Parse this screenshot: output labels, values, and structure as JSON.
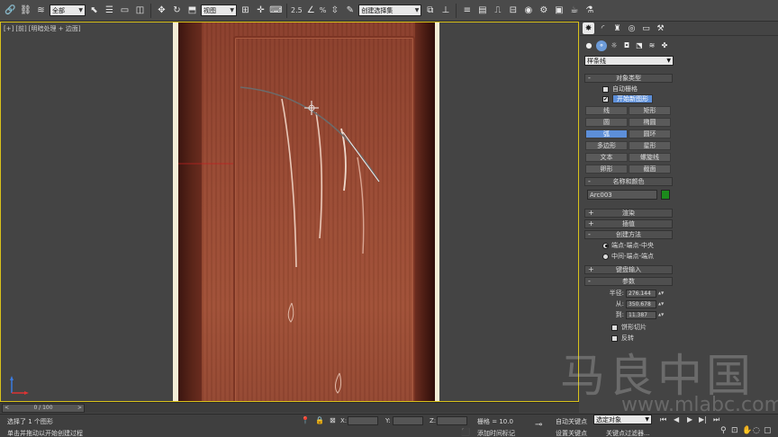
{
  "toolbar": {
    "filter_select": "全部",
    "view_select": "视图",
    "selection_set_select": "创建选择集",
    "snap_labels": [
      "2.5",
      "%"
    ]
  },
  "viewport": {
    "label_parts": [
      "[+]",
      "[前]",
      "[明暗处理 + 边面]"
    ]
  },
  "command_panel": {
    "category_select": "样条线",
    "object_type": {
      "title": "对象类型",
      "auto_grid_label": "自动栅格",
      "start_new_shape_label": "开始新图形",
      "start_new_shape_checked": true,
      "buttons": [
        {
          "label": "线",
          "active": false
        },
        {
          "label": "矩形",
          "active": false
        },
        {
          "label": "圆",
          "active": false
        },
        {
          "label": "椭圆",
          "active": false
        },
        {
          "label": "弧",
          "active": true
        },
        {
          "label": "圆环",
          "active": false
        },
        {
          "label": "多边形",
          "active": false
        },
        {
          "label": "星形",
          "active": false
        },
        {
          "label": "文本",
          "active": false
        },
        {
          "label": "螺旋线",
          "active": false
        },
        {
          "label": "卵形",
          "active": false
        },
        {
          "label": "截面",
          "active": false
        }
      ]
    },
    "name_color": {
      "title": "名称和颜色",
      "name_value": "Arc003",
      "color": "#1c8a1c"
    },
    "rendering_title": "渲染",
    "interpolation_title": "插值",
    "creation_method": {
      "title": "创建方法",
      "option_1": "端点-端点-中央",
      "option_2": "中间-端点-端点",
      "selected": 1
    },
    "keyboard_input_title": "键盘输入",
    "parameters": {
      "title": "参数",
      "radius_label": "半径:",
      "radius_value": "276.144",
      "from_label": "从:",
      "from_value": "350.678",
      "to_label": "到:",
      "to_value": "11.387",
      "pie_slice_label": "饼形切片",
      "reverse_label": "反转"
    }
  },
  "timeline": {
    "frame_label": "0 / 100"
  },
  "status": {
    "selection_text": "选择了 1 个图形",
    "prompt_text": "单击并拖动以开始创建过程",
    "x_label": "X:",
    "y_label": "Y:",
    "z_label": "Z:",
    "grid_text": "栅格 = 10.0",
    "add_time_tag": "添加时间标记",
    "auto_key": "自动关键点",
    "set_key": "设置关键点",
    "key_select": "选定对象",
    "key_filters": "关键点过滤器..."
  },
  "watermark": {
    "text": "马良中国",
    "url": "www.mlabc.com"
  },
  "colors": {
    "accent_blue": "#5d8fd9",
    "viewport_border": "#d9c21a",
    "door_wood": "#9a4a33"
  }
}
